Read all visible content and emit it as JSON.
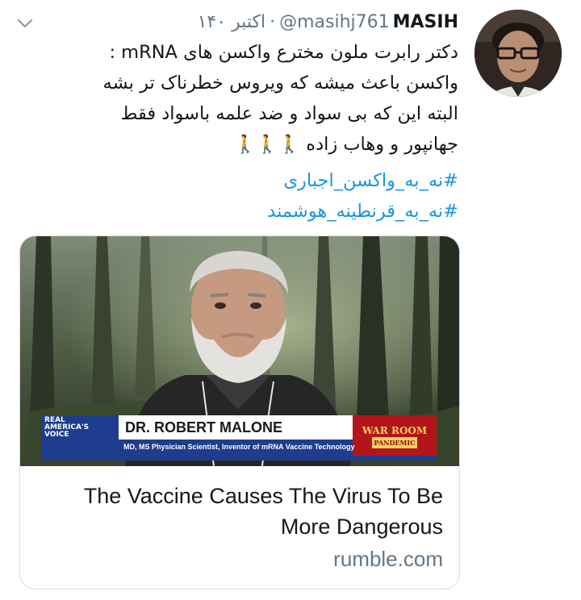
{
  "header": {
    "date": "۱۴۰ اکتبر",
    "separator": "·",
    "handle": "@masihj761",
    "display_name": "MASIH"
  },
  "tweet": {
    "lines": [
      "دکتر رابرت ملون مخترع واکسن های mRNA :",
      "واکسن باعث میشه که ویروس خطرناک تر بشه",
      "البته این که بی سواد و ضد علمه باسواد فقط",
      "جهانپور و وهاب زاده"
    ],
    "emoji": "🚶🚶🚶"
  },
  "hashtags": [
    "#نه_به_واکسن_اجباری",
    "#نه_به_قرنطینه_هوشمند"
  ],
  "card": {
    "lower_third": {
      "network_line1": "REAL",
      "network_line2": "AMERICA'S",
      "network_line3": "VOICE",
      "name": "DR. ROBERT MALONE",
      "subtitle": "MD, MS Physician Scientist, Inventor of mRNA Vaccine Technology",
      "show_name": "WAR ROOM",
      "show_tag": "PANDEMIC"
    },
    "title_line1": "The Vaccine Causes The Virus To Be",
    "title_line2": "More Dangerous",
    "domain": "rumble.com"
  },
  "colors": {
    "link": "#1b95e0",
    "secondary_text": "#657786",
    "primary_text": "#14171a",
    "border": "#d7dde2"
  },
  "icons": {
    "chevron": "chevron-down-icon"
  }
}
